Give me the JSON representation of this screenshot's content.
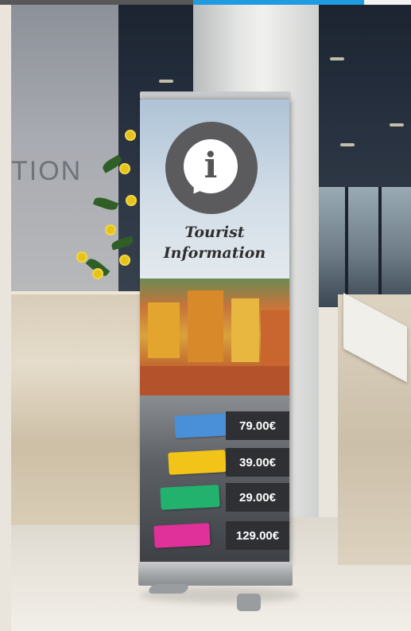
{
  "scene": {
    "wall_sign_text": "TION"
  },
  "banner": {
    "icon": "info-speech-bubble-icon",
    "icon_glyph": "i",
    "title_line1": "Tourist",
    "title_line2": "Information",
    "rows": [
      {
        "tag_color": "#4a90d9",
        "price": "79.00€"
      },
      {
        "tag_color": "#f2c318",
        "price": "39.00€"
      },
      {
        "tag_color": "#23b26d",
        "price": "29.00€"
      },
      {
        "tag_color": "#e0319a",
        "price": "129.00€"
      }
    ]
  },
  "colors": {
    "accent_blue": "#1f9be0",
    "banner_dark": "#2e3034",
    "icon_gray": "#5b5b5d"
  }
}
